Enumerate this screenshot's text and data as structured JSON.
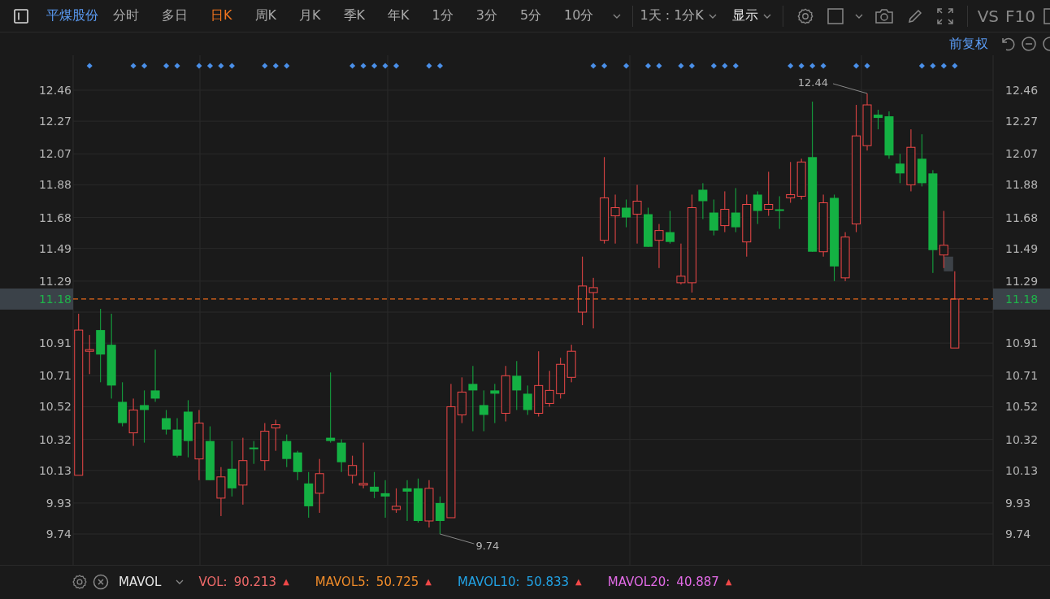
{
  "stock_name": "平煤股份",
  "tabs": [
    {
      "label": "分时",
      "selected": false
    },
    {
      "label": "多日",
      "selected": false
    },
    {
      "label": "日K",
      "selected": true
    },
    {
      "label": "周K",
      "selected": false
    },
    {
      "label": "月K",
      "selected": false
    },
    {
      "label": "季K",
      "selected": false
    },
    {
      "label": "年K",
      "selected": false
    },
    {
      "label": "1分",
      "selected": false
    },
    {
      "label": "3分",
      "selected": false
    },
    {
      "label": "5分",
      "selected": false
    },
    {
      "label": "10分",
      "selected": false
    }
  ],
  "period_dropdown": {
    "label": "1天 : 1分K"
  },
  "display_menu": {
    "label": "显示"
  },
  "tool_texts": [
    "VS",
    "F10"
  ],
  "adjust_mode": "前复权",
  "chart": {
    "events": [
      {
        "marked": false
      },
      {
        "marked": true
      },
      {
        "marked": false
      },
      {
        "marked": false
      },
      {
        "marked": false
      },
      {
        "marked": true
      },
      {
        "marked": true
      },
      {
        "marked": false
      },
      {
        "marked": true
      },
      {
        "marked": true
      },
      {
        "marked": false
      },
      {
        "marked": true
      },
      {
        "marked": true
      },
      {
        "marked": true
      },
      {
        "marked": true
      },
      {
        "marked": false
      },
      {
        "marked": false
      },
      {
        "marked": true
      },
      {
        "marked": true
      },
      {
        "marked": true
      },
      {
        "marked": false
      },
      {
        "marked": false
      },
      {
        "marked": false
      },
      {
        "marked": false
      },
      {
        "marked": false
      },
      {
        "marked": true
      },
      {
        "marked": true
      },
      {
        "marked": true
      },
      {
        "marked": true
      },
      {
        "marked": true
      },
      {
        "marked": false
      },
      {
        "marked": false
      },
      {
        "marked": true
      },
      {
        "marked": true
      },
      {
        "marked": false
      },
      {
        "marked": false
      },
      {
        "marked": false
      },
      {
        "marked": false
      },
      {
        "marked": false
      },
      {
        "marked": false
      },
      {
        "marked": false
      },
      {
        "marked": false
      },
      {
        "marked": false
      },
      {
        "marked": false
      },
      {
        "marked": false
      },
      {
        "marked": false
      },
      {
        "marked": false
      },
      {
        "marked": true
      },
      {
        "marked": true
      },
      {
        "marked": false
      },
      {
        "marked": true
      },
      {
        "marked": false
      },
      {
        "marked": true
      },
      {
        "marked": true
      },
      {
        "marked": false
      },
      {
        "marked": true
      },
      {
        "marked": true
      },
      {
        "marked": false
      },
      {
        "marked": true
      },
      {
        "marked": true
      },
      {
        "marked": true
      },
      {
        "marked": false
      },
      {
        "marked": false
      },
      {
        "marked": false
      },
      {
        "marked": false
      },
      {
        "marked": true
      },
      {
        "marked": true
      },
      {
        "marked": true
      },
      {
        "marked": true
      },
      {
        "marked": false
      },
      {
        "marked": false
      },
      {
        "marked": true
      },
      {
        "marked": true
      },
      {
        "marked": false
      },
      {
        "marked": false
      },
      {
        "marked": false
      },
      {
        "marked": false
      },
      {
        "marked": true
      },
      {
        "marked": true
      },
      {
        "marked": true
      },
      {
        "marked": true
      }
    ],
    "chart_data": {
      "type": "candlestick",
      "grid": true,
      "ylim": [
        9.551,
        12.674
      ],
      "yticks": [
        {
          "value": 12.46,
          "label": "12.46"
        },
        {
          "value": 12.27,
          "label": "12.27"
        },
        {
          "value": 12.07,
          "label": "12.07"
        },
        {
          "value": 11.88,
          "label": "11.88"
        },
        {
          "value": 11.68,
          "label": "11.68"
        },
        {
          "value": 11.49,
          "label": "11.49"
        },
        {
          "value": 11.29,
          "label": "11.29"
        },
        {
          "value": 10.91,
          "label": "10.91"
        },
        {
          "value": 10.71,
          "label": "10.71"
        },
        {
          "value": 10.52,
          "label": "10.52"
        },
        {
          "value": 10.32,
          "label": "10.32"
        },
        {
          "value": 10.13,
          "label": "10.13"
        },
        {
          "value": 9.93,
          "label": "9.93"
        },
        {
          "value": 9.74,
          "label": "9.74"
        }
      ],
      "categories": [
        null,
        null,
        null,
        null,
        null,
        null,
        null,
        null,
        null,
        null,
        null,
        null,
        null,
        null,
        null,
        null,
        null,
        null,
        null,
        null,
        null,
        null,
        null,
        null,
        null,
        null,
        null,
        null,
        null,
        null,
        null,
        null,
        null,
        null,
        null,
        null,
        null,
        null,
        null,
        null,
        null,
        null,
        null,
        null,
        null,
        null,
        null,
        null,
        null,
        null,
        null,
        null,
        null,
        null,
        null,
        null,
        null,
        null,
        null,
        null,
        null,
        null,
        null,
        null,
        null,
        null,
        null,
        null,
        null,
        null,
        null,
        null,
        null,
        null,
        null,
        null,
        null,
        null,
        null,
        null,
        null,
        null,
        null,
        null
      ],
      "ohlc": [
        [
          10.1,
          11.09,
          10.1,
          10.99
        ],
        [
          10.86,
          10.96,
          10.72,
          10.87
        ],
        [
          10.99,
          11.12,
          10.67,
          10.84
        ],
        [
          10.9,
          11.09,
          10.57,
          10.65
        ],
        [
          10.55,
          10.67,
          10.4,
          10.42
        ],
        [
          10.36,
          10.57,
          10.28,
          10.5
        ],
        [
          10.53,
          10.62,
          10.3,
          10.5
        ],
        [
          10.62,
          10.87,
          10.55,
          10.57
        ],
        [
          10.45,
          10.5,
          10.35,
          10.38
        ],
        [
          10.38,
          10.45,
          10.21,
          10.22
        ],
        [
          10.49,
          10.56,
          10.21,
          10.31
        ],
        [
          10.2,
          10.5,
          10.07,
          10.42
        ],
        [
          10.31,
          10.4,
          10.07,
          10.07
        ],
        [
          9.96,
          10.15,
          9.85,
          10.09
        ],
        [
          10.14,
          10.31,
          9.97,
          10.02
        ],
        [
          10.04,
          10.33,
          9.92,
          10.19
        ],
        [
          10.27,
          10.31,
          10.17,
          10.26
        ],
        [
          10.19,
          10.42,
          10.13,
          10.37
        ],
        [
          10.39,
          10.44,
          10.25,
          10.41
        ],
        [
          10.31,
          10.35,
          10.15,
          10.2
        ],
        [
          10.24,
          10.25,
          10.07,
          10.12
        ],
        [
          10.05,
          10.12,
          9.84,
          9.91
        ],
        [
          9.99,
          10.2,
          9.87,
          10.11
        ],
        [
          10.33,
          10.73,
          10.3,
          10.31
        ],
        [
          10.3,
          10.32,
          10.12,
          10.18
        ],
        [
          10.1,
          10.22,
          10.05,
          10.16
        ],
        [
          10.04,
          10.3,
          10.02,
          10.05
        ],
        [
          10.03,
          10.12,
          9.96,
          10.0
        ],
        [
          9.99,
          10.07,
          9.84,
          9.97
        ],
        [
          9.89,
          10.02,
          9.87,
          9.91
        ],
        [
          10.02,
          10.07,
          9.82,
          10.0
        ],
        [
          10.02,
          10.08,
          9.81,
          9.82
        ],
        [
          9.82,
          10.07,
          9.78,
          10.02
        ],
        [
          9.93,
          9.97,
          9.74,
          9.82
        ],
        [
          9.84,
          10.66,
          9.84,
          10.52
        ],
        [
          10.47,
          10.7,
          10.42,
          10.61
        ],
        [
          10.66,
          10.77,
          10.37,
          10.62
        ],
        [
          10.53,
          10.62,
          10.37,
          10.47
        ],
        [
          10.62,
          10.66,
          10.42,
          10.6
        ],
        [
          10.48,
          10.77,
          10.43,
          10.71
        ],
        [
          10.71,
          10.8,
          10.5,
          10.62
        ],
        [
          10.6,
          10.65,
          10.47,
          10.5
        ],
        [
          10.48,
          10.86,
          10.46,
          10.65
        ],
        [
          10.54,
          10.74,
          10.52,
          10.62
        ],
        [
          10.6,
          10.82,
          10.57,
          10.78
        ],
        [
          10.7,
          10.9,
          10.67,
          10.86
        ],
        [
          11.1,
          11.44,
          11.02,
          11.26
        ],
        [
          11.22,
          11.31,
          11.0,
          11.25
        ],
        [
          11.54,
          12.05,
          11.52,
          11.8
        ],
        [
          11.69,
          11.82,
          11.52,
          11.74
        ],
        [
          11.74,
          11.79,
          11.62,
          11.68
        ],
        [
          11.7,
          11.88,
          11.52,
          11.78
        ],
        [
          11.7,
          11.74,
          11.5,
          11.5
        ],
        [
          11.54,
          11.64,
          11.37,
          11.6
        ],
        [
          11.59,
          11.72,
          11.52,
          11.53
        ],
        [
          11.28,
          11.52,
          11.27,
          11.32
        ],
        [
          11.28,
          11.82,
          11.22,
          11.74
        ],
        [
          11.85,
          11.89,
          11.67,
          11.78
        ],
        [
          11.71,
          11.79,
          11.57,
          11.6
        ],
        [
          11.63,
          11.84,
          11.59,
          11.73
        ],
        [
          11.71,
          11.86,
          11.59,
          11.62
        ],
        [
          11.53,
          11.82,
          11.44,
          11.76
        ],
        [
          11.82,
          11.84,
          11.64,
          11.72
        ],
        [
          11.73,
          11.96,
          11.69,
          11.76
        ],
        [
          11.73,
          11.81,
          11.61,
          11.72
        ],
        [
          11.8,
          12.02,
          11.77,
          11.82
        ],
        [
          11.81,
          12.04,
          11.79,
          12.02
        ],
        [
          12.05,
          12.39,
          11.47,
          11.47
        ],
        [
          11.47,
          11.82,
          11.44,
          11.77
        ],
        [
          11.8,
          11.82,
          11.29,
          11.38
        ],
        [
          11.31,
          11.59,
          11.29,
          11.56
        ],
        [
          11.64,
          12.37,
          11.59,
          12.18
        ],
        [
          12.12,
          12.44,
          12.09,
          12.37
        ],
        [
          12.31,
          12.34,
          12.22,
          12.29
        ],
        [
          12.3,
          12.33,
          12.04,
          12.06
        ],
        [
          12.01,
          12.07,
          11.89,
          11.95
        ],
        [
          11.88,
          12.22,
          11.84,
          12.11
        ],
        [
          12.04,
          12.19,
          11.87,
          11.89
        ],
        [
          11.95,
          11.97,
          11.34,
          11.48
        ],
        [
          11.45,
          11.72,
          11.37,
          11.51
        ],
        [
          10.88,
          11.35,
          10.88,
          11.18
        ],
        null,
        null,
        null
      ],
      "annotations": [
        "12.44",
        "9.74"
      ],
      "ref_lines": [
        {
          "axis": "y",
          "value": 11.18,
          "label": "11.18"
        }
      ]
    }
  },
  "indicator_bar": {
    "name": "MAVOL",
    "items": [
      {
        "label": "VOL:",
        "value": "90.213",
        "arrow": "▲",
        "color": "#f26b6b"
      },
      {
        "label": "MAVOL5:",
        "value": "50.725",
        "arrow": "▲",
        "color": "#f08c2a"
      },
      {
        "label": "MAVOL10:",
        "value": "50.833",
        "arrow": "▲",
        "color": "#22a3e6"
      },
      {
        "label": "MAVOL20:",
        "value": "40.887",
        "arrow": "▲",
        "color": "#e26be6"
      }
    ]
  }
}
